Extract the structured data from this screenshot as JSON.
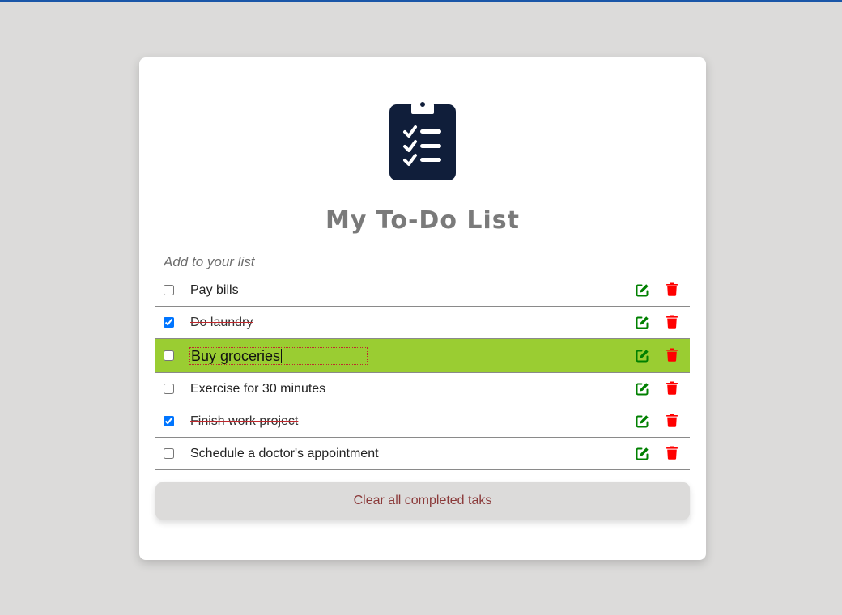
{
  "app": {
    "title": "My To-Do List",
    "input_placeholder": "Add to your list",
    "clear_label": "Clear all completed taks"
  },
  "colors": {
    "background": "#dcdbda",
    "card": "#ffffff",
    "title": "#7a7a7a",
    "logo": "#101e3a",
    "edit_icon": "#008000",
    "delete_icon": "#ff0000",
    "editing_row": "#9acd32",
    "strike": "#c0282d",
    "clear_text": "#8b3a3a"
  },
  "icons": {
    "logo": "clipboard-list-icon",
    "edit": "pen-to-square-icon",
    "delete": "trash-can-icon"
  },
  "todos": [
    {
      "text": "Pay bills",
      "done": false,
      "editing": false
    },
    {
      "text": "Do laundry",
      "done": true,
      "editing": false
    },
    {
      "text": "Buy groceries",
      "done": false,
      "editing": true
    },
    {
      "text": "Exercise for 30 minutes",
      "done": false,
      "editing": false
    },
    {
      "text": "Finish work project",
      "done": true,
      "editing": false
    },
    {
      "text": "Schedule a doctor's appointment",
      "done": false,
      "editing": false
    }
  ]
}
